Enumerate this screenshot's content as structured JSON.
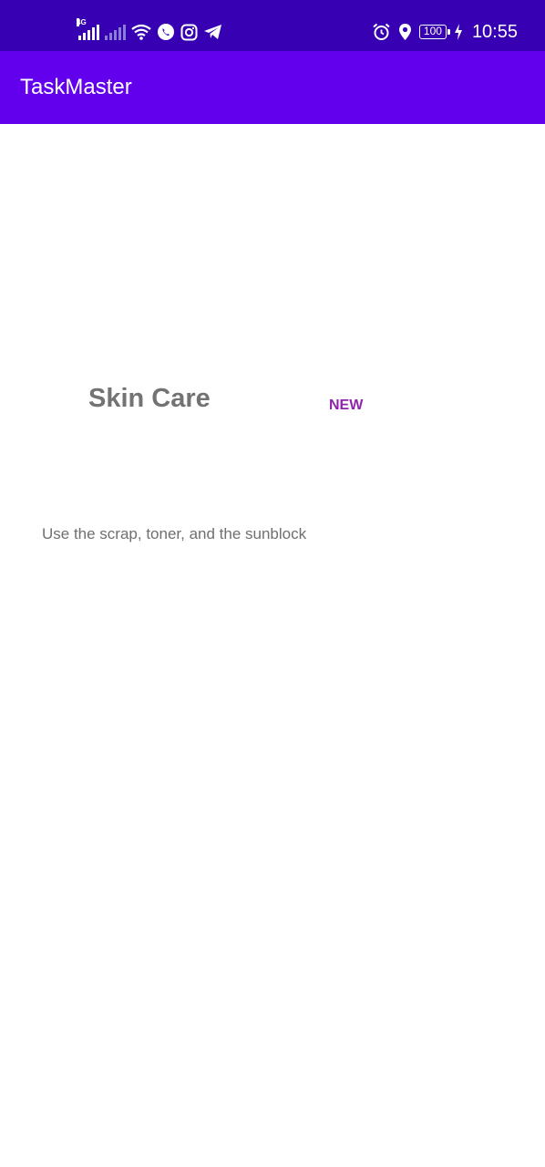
{
  "status_bar": {
    "network_type": "4G",
    "battery_level": "100",
    "time": "10:55",
    "left_icons": [
      "signal-4g-icon",
      "signal-no-sim-icon",
      "wifi-icon",
      "whatsapp-icon",
      "instagram-icon",
      "telegram-icon"
    ],
    "right_icons": [
      "alarm-icon",
      "location-icon",
      "battery-icon",
      "charging-icon"
    ]
  },
  "app_bar": {
    "title": "TaskMaster"
  },
  "task": {
    "title": "Skin Care",
    "status": "NEW",
    "body": "Use the scrap, toner, and the sunblock"
  },
  "colors": {
    "status_bar": "#3700B3",
    "app_bar": "#6200EE",
    "title_text": "#737373",
    "status_text": "#8E24AA",
    "body_text": "#6F6F6F"
  }
}
